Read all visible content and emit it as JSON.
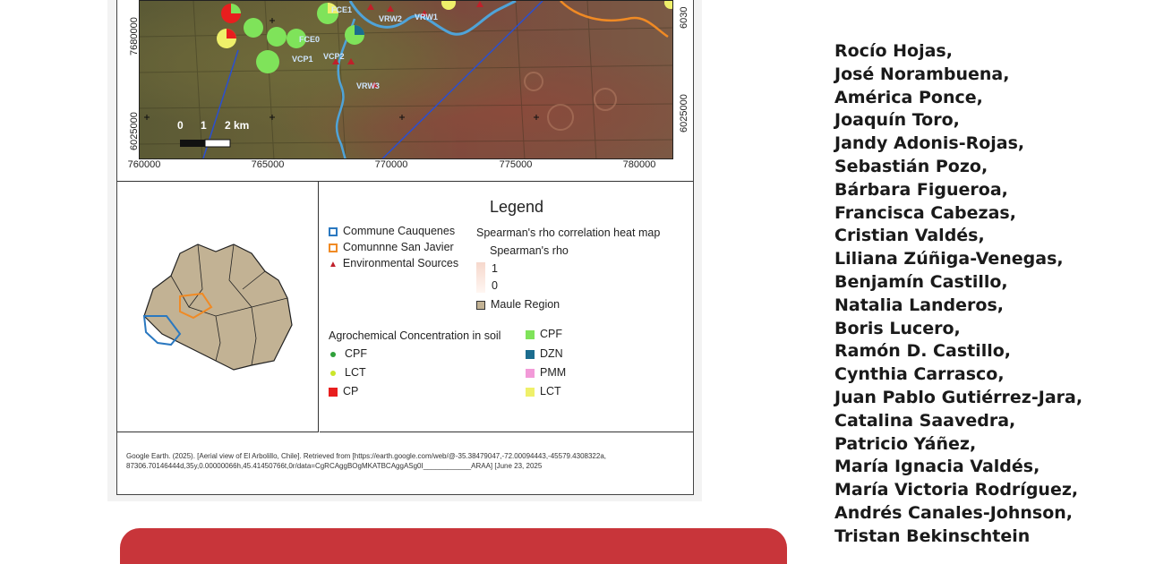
{
  "map": {
    "x_ticks": [
      "760000",
      "765000",
      "770000",
      "775000",
      "780000"
    ],
    "y_ticks_left": [
      "7680000",
      "6025000"
    ],
    "y_ticks_right": [
      "6030",
      "6025000"
    ],
    "scale": [
      "0",
      "1",
      "2 km"
    ],
    "site_labels": [
      "FCE1",
      "VRW2",
      "VRW1",
      "FCE0",
      "VCP1",
      "VCP2",
      "VRW3"
    ]
  },
  "legend": {
    "title": "Legend",
    "commune_cauquenes": "Commune Cauquenes",
    "commune_san_javier": "Comunnne San Javier",
    "environmental_sources": "Environmental Sources",
    "heatmap_title": "Spearman's  rho correlation heat map",
    "spearman_label": "Spearman's rho",
    "val_1": "1",
    "val_0": "0",
    "maule_region": "Maule Region",
    "agro_title": "Agrochemical Concentration in soil",
    "pts": [
      "CPF",
      "LCT",
      "CP"
    ],
    "sq": [
      "CPF",
      "DZN",
      "PMM",
      "LCT"
    ]
  },
  "colors": {
    "cauquenes": "#2a78c0",
    "san_javier": "#f08a24",
    "source": "#c0202a",
    "maule": "#c2b294",
    "cpf_pt": "#2fa03a",
    "lct_pt": "#cbe62a",
    "cp": "#e81e1e",
    "cpf_sq": "#7fe35a",
    "dzn_sq": "#1b6c8e",
    "pmm_sq": "#f29ad8",
    "lct_sq": "#eff06a",
    "bar": "#c8353a"
  },
  "citation": "Google Earth. (2025). [Aerial view of El Arbolillo, Chile]. Retrieved from [https://earth.google.com/web/@-35.38479047,-72.00094443,-45579.4308322a, 87306.70146444d,35y,0.00000066h,45.41450766t,0r/data=CgRCAggBOgMKATBCAggASg0I____________ARAA] [June 23, 2025",
  "authors": [
    "Rocío Hojas,",
    "José Norambuena,",
    "América Ponce,",
    "Joaquín Toro,",
    "Jandy Adonis-Rojas,",
    "Sebastián Pozo,",
    "Bárbara Figueroa,",
    "Francisca Cabezas,",
    "Cristian Valdés,",
    "Liliana Zúñiga-Venegas,",
    "Benjamín Castillo,",
    "Natalia Landeros,",
    "Boris Lucero,",
    "Ramón D. Castillo,",
    "Cynthia Carrasco,",
    "Juan Pablo Gutiérrez-Jara,",
    "Catalina Saavedra,",
    "Patricio Yáñez,",
    "María Ignacia Valdés,",
    "María Victoria Rodríguez,",
    "Andrés Canales-Johnson,",
    "Tristan Bekinschtein"
  ]
}
